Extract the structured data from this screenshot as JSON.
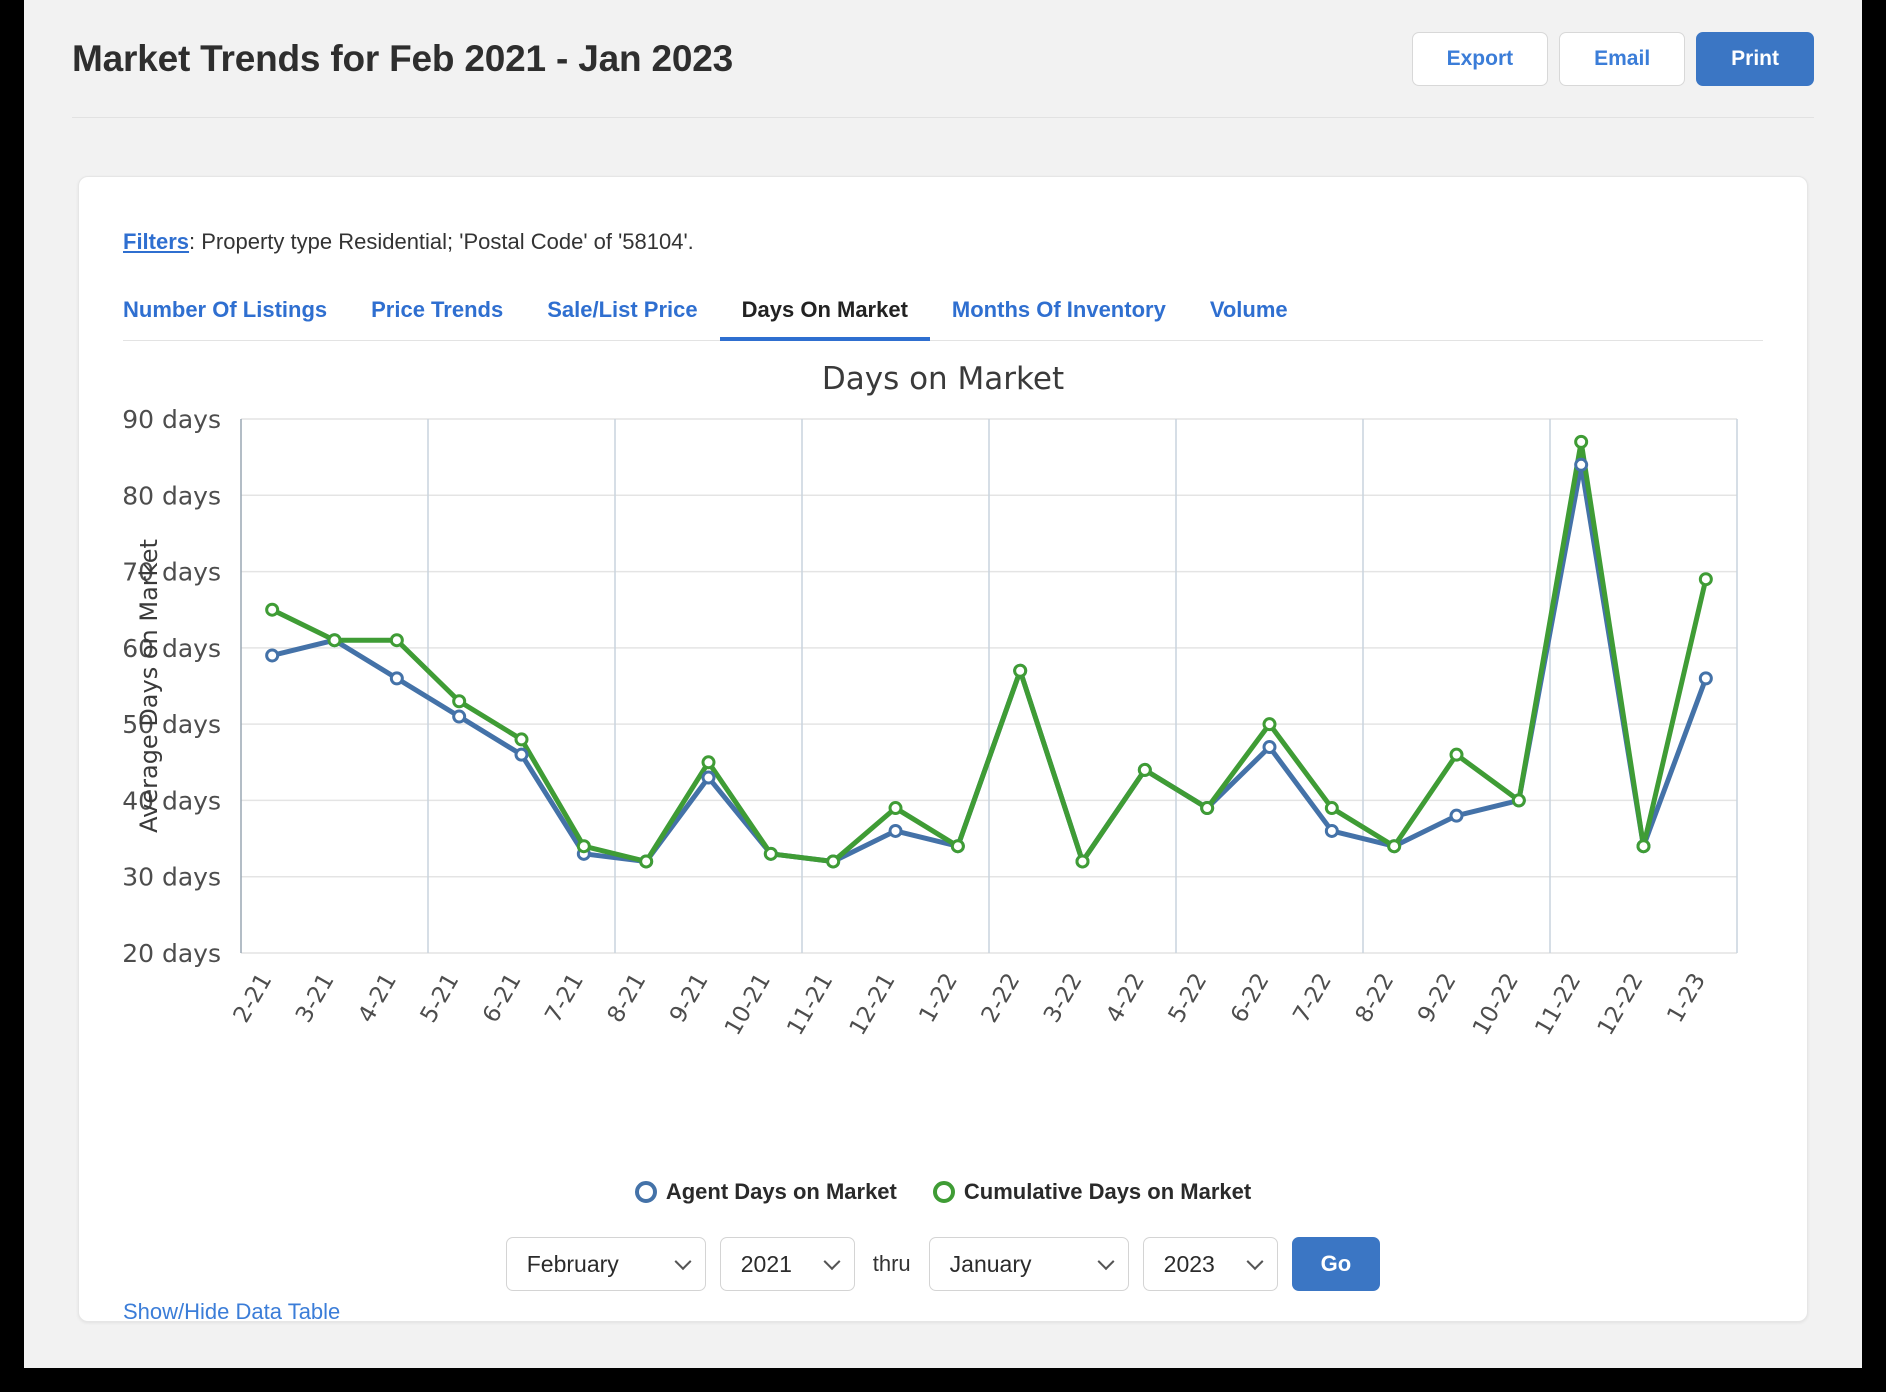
{
  "header": {
    "title": "Market Trends for Feb 2021 - Jan 2023",
    "buttons": [
      {
        "label": "Export",
        "style": "outline"
      },
      {
        "label": "Email",
        "style": "outline"
      },
      {
        "label": "Print",
        "style": "primary"
      }
    ]
  },
  "filters": {
    "link_label": "Filters",
    "text": ": Property type Residential; 'Postal Code' of '58104'."
  },
  "tabs": [
    {
      "label": "Number Of Listings",
      "active": false
    },
    {
      "label": "Price Trends",
      "active": false
    },
    {
      "label": "Sale/List Price",
      "active": false
    },
    {
      "label": "Days On Market",
      "active": true
    },
    {
      "label": "Months Of Inventory",
      "active": false
    },
    {
      "label": "Volume",
      "active": false
    }
  ],
  "legend": [
    {
      "label": "Agent Days on Market",
      "color": "#4472a8"
    },
    {
      "label": "Cumulative Days on Market",
      "color": "#3f9c35"
    }
  ],
  "date_controls": {
    "from_month": "February",
    "from_year": "2021",
    "thru_label": "thru",
    "to_month": "January",
    "to_year": "2023",
    "go_label": "Go"
  },
  "footer": {
    "show_hide_label": "Show/Hide Data Table"
  },
  "colors": {
    "accent_blue": "#3b76c4",
    "link_blue": "#2f6fd0",
    "series_blue": "#4472a8",
    "series_green": "#3f9c35",
    "card_bg": "#ffffff",
    "page_bg": "#f2f2f2"
  },
  "chart_data": {
    "type": "line",
    "title": "Days on Market",
    "xlabel": "",
    "ylabel": "Average Days on Market",
    "ylim": [
      20,
      90
    ],
    "ytick_step": 10,
    "ytick_labels": [
      "20 days",
      "30 days",
      "40 days",
      "50 days",
      "60 days",
      "70 days",
      "80 days",
      "90 days"
    ],
    "grid": true,
    "legend_position": "bottom",
    "categories": [
      "2-21",
      "3-21",
      "4-21",
      "5-21",
      "6-21",
      "7-21",
      "8-21",
      "9-21",
      "10-21",
      "11-21",
      "12-21",
      "1-22",
      "2-22",
      "3-22",
      "4-22",
      "5-22",
      "6-22",
      "7-22",
      "8-22",
      "9-22",
      "10-22",
      "11-22",
      "12-22",
      "1-23"
    ],
    "series": [
      {
        "name": "Agent Days on Market",
        "color": "#4472a8",
        "values": [
          59,
          61,
          56,
          51,
          46,
          33,
          32,
          43,
          33,
          32,
          36,
          34,
          57,
          32,
          44,
          39,
          47,
          36,
          34,
          38,
          40,
          84,
          34,
          56
        ]
      },
      {
        "name": "Cumulative Days on Market",
        "color": "#3f9c35",
        "values": [
          65,
          61,
          61,
          53,
          48,
          34,
          32,
          45,
          33,
          32,
          39,
          34,
          57,
          32,
          44,
          39,
          50,
          39,
          34,
          46,
          40,
          87,
          34,
          69
        ]
      }
    ]
  }
}
